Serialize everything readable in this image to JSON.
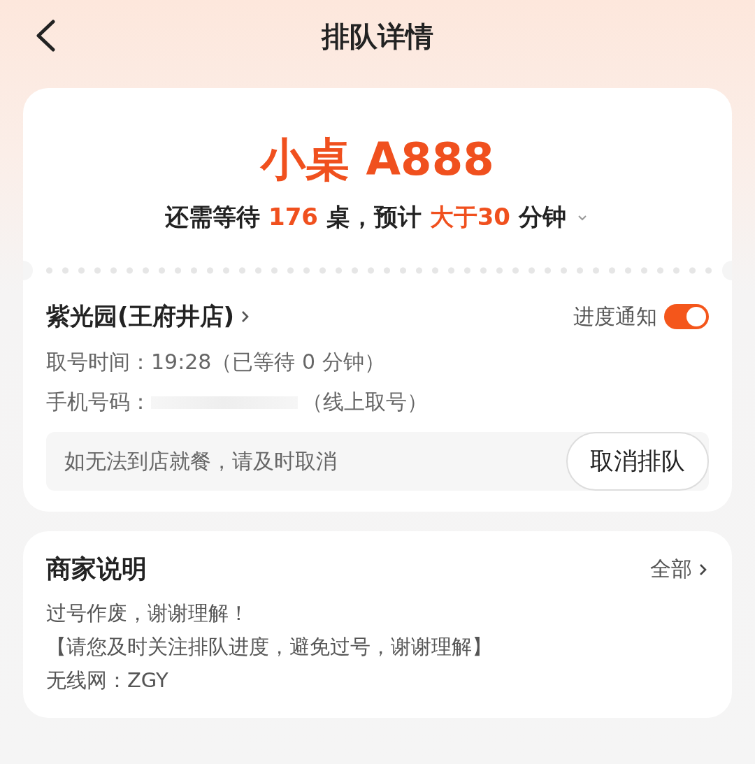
{
  "header": {
    "title": "排队详情"
  },
  "ticket": {
    "number": "小桌 A888",
    "wait_parts": [
      {
        "text": "还需等待 ",
        "accent": false
      },
      {
        "text": "176",
        "accent": true
      },
      {
        "text": " 桌，预计 ",
        "accent": false
      },
      {
        "text": "大于30",
        "accent": true
      },
      {
        "text": " 分钟",
        "accent": false
      }
    ]
  },
  "store": {
    "name": "紫光园(王府井店)",
    "notify_label": "进度通知",
    "notify_on": true,
    "take_time": "取号时间：19:28（已等待 0 分钟）",
    "phone_label": "手机号码：",
    "phone_note": "（线上取号）",
    "cancel_hint": "如无法到店就餐，请及时取消",
    "cancel_button": "取消排队"
  },
  "notes": {
    "title": "商家说明",
    "more": "全部",
    "lines": [
      "过号作废，谢谢理解！",
      "【请您及时关注排队进度，避免过号，谢谢理解】",
      "无线网：ZGY"
    ]
  }
}
